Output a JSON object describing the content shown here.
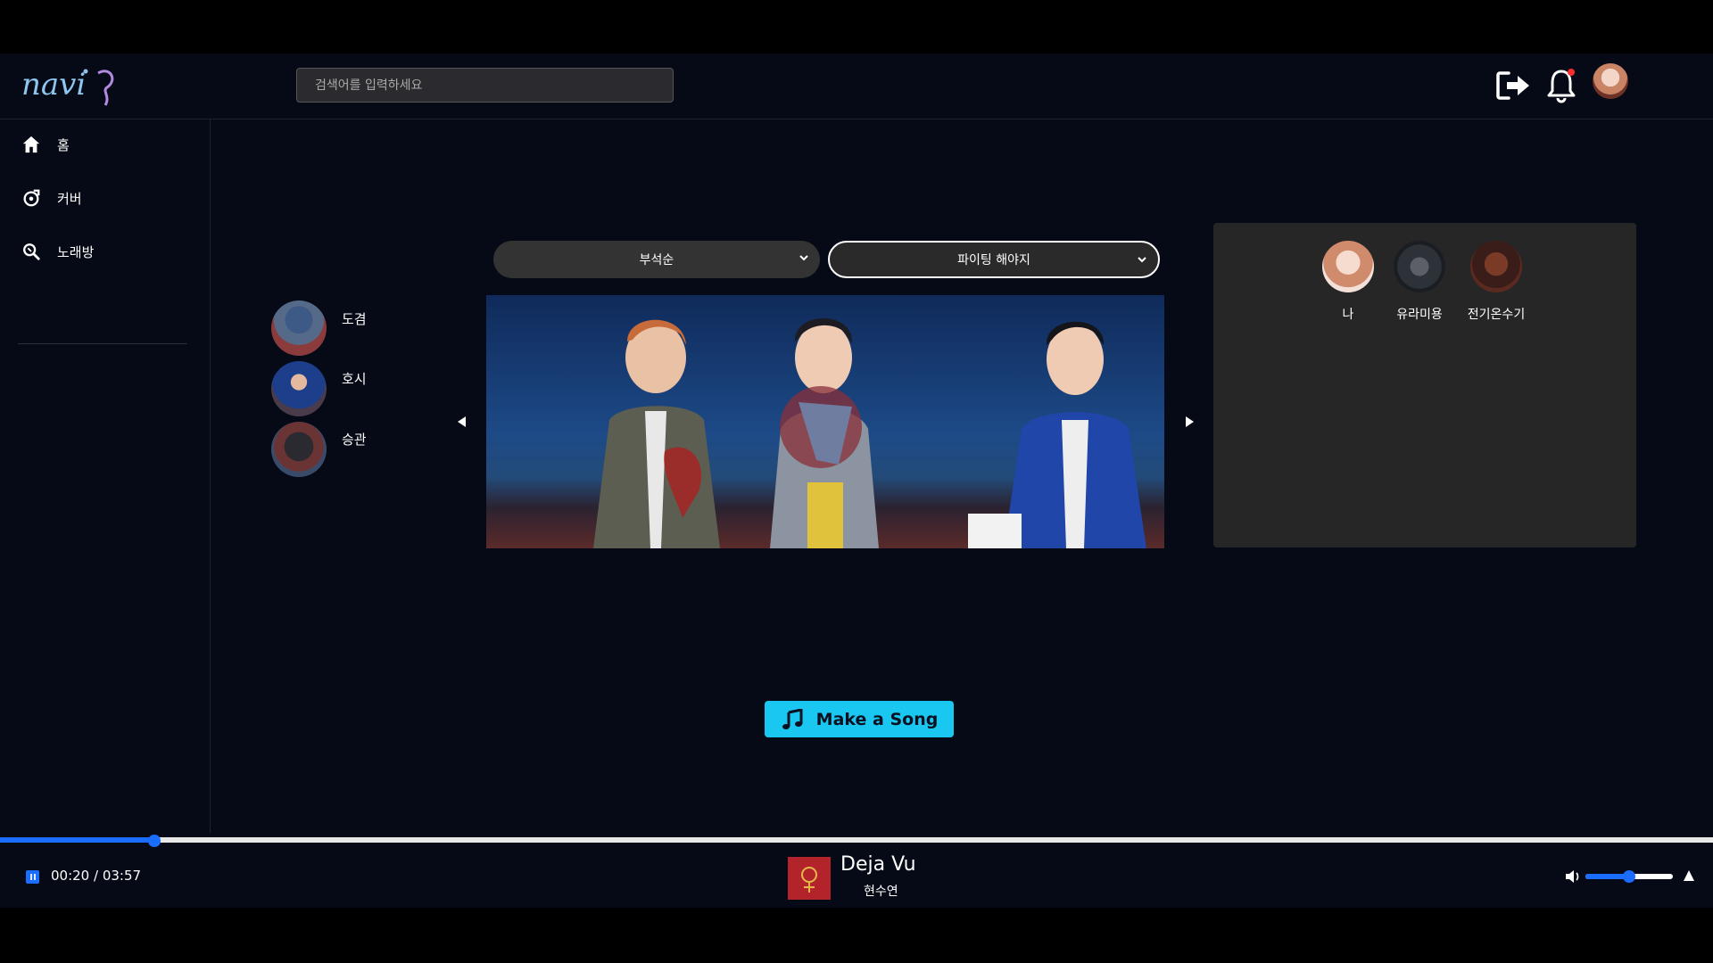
{
  "header": {
    "logo_text": "navi",
    "search_placeholder": "검색어를 입력하세요",
    "notification_dot_color": "#ff2d2d"
  },
  "sidebar": {
    "items": [
      {
        "label": "홈",
        "icon": "home-icon"
      },
      {
        "label": "커버",
        "icon": "cover-icon"
      },
      {
        "label": "노래방",
        "icon": "karaoke-search-icon"
      }
    ]
  },
  "filters": {
    "unit_select": "부석순",
    "song_select": "파이팅 해야지"
  },
  "singers": [
    {
      "name": "도겸"
    },
    {
      "name": "호시"
    },
    {
      "name": "승관"
    }
  ],
  "participants": [
    {
      "name": "나"
    },
    {
      "name": "유라미용"
    },
    {
      "name": "전기온수기"
    }
  ],
  "make_button": {
    "label": "Make a Song",
    "color": "#19c7f0"
  },
  "player": {
    "current_time": "00:20",
    "separator": " / ",
    "duration": "03:57",
    "progress": 0.09,
    "volume": 0.5,
    "title": "Deja Vu",
    "artist": "현수연",
    "accent": "#1a6dff"
  }
}
